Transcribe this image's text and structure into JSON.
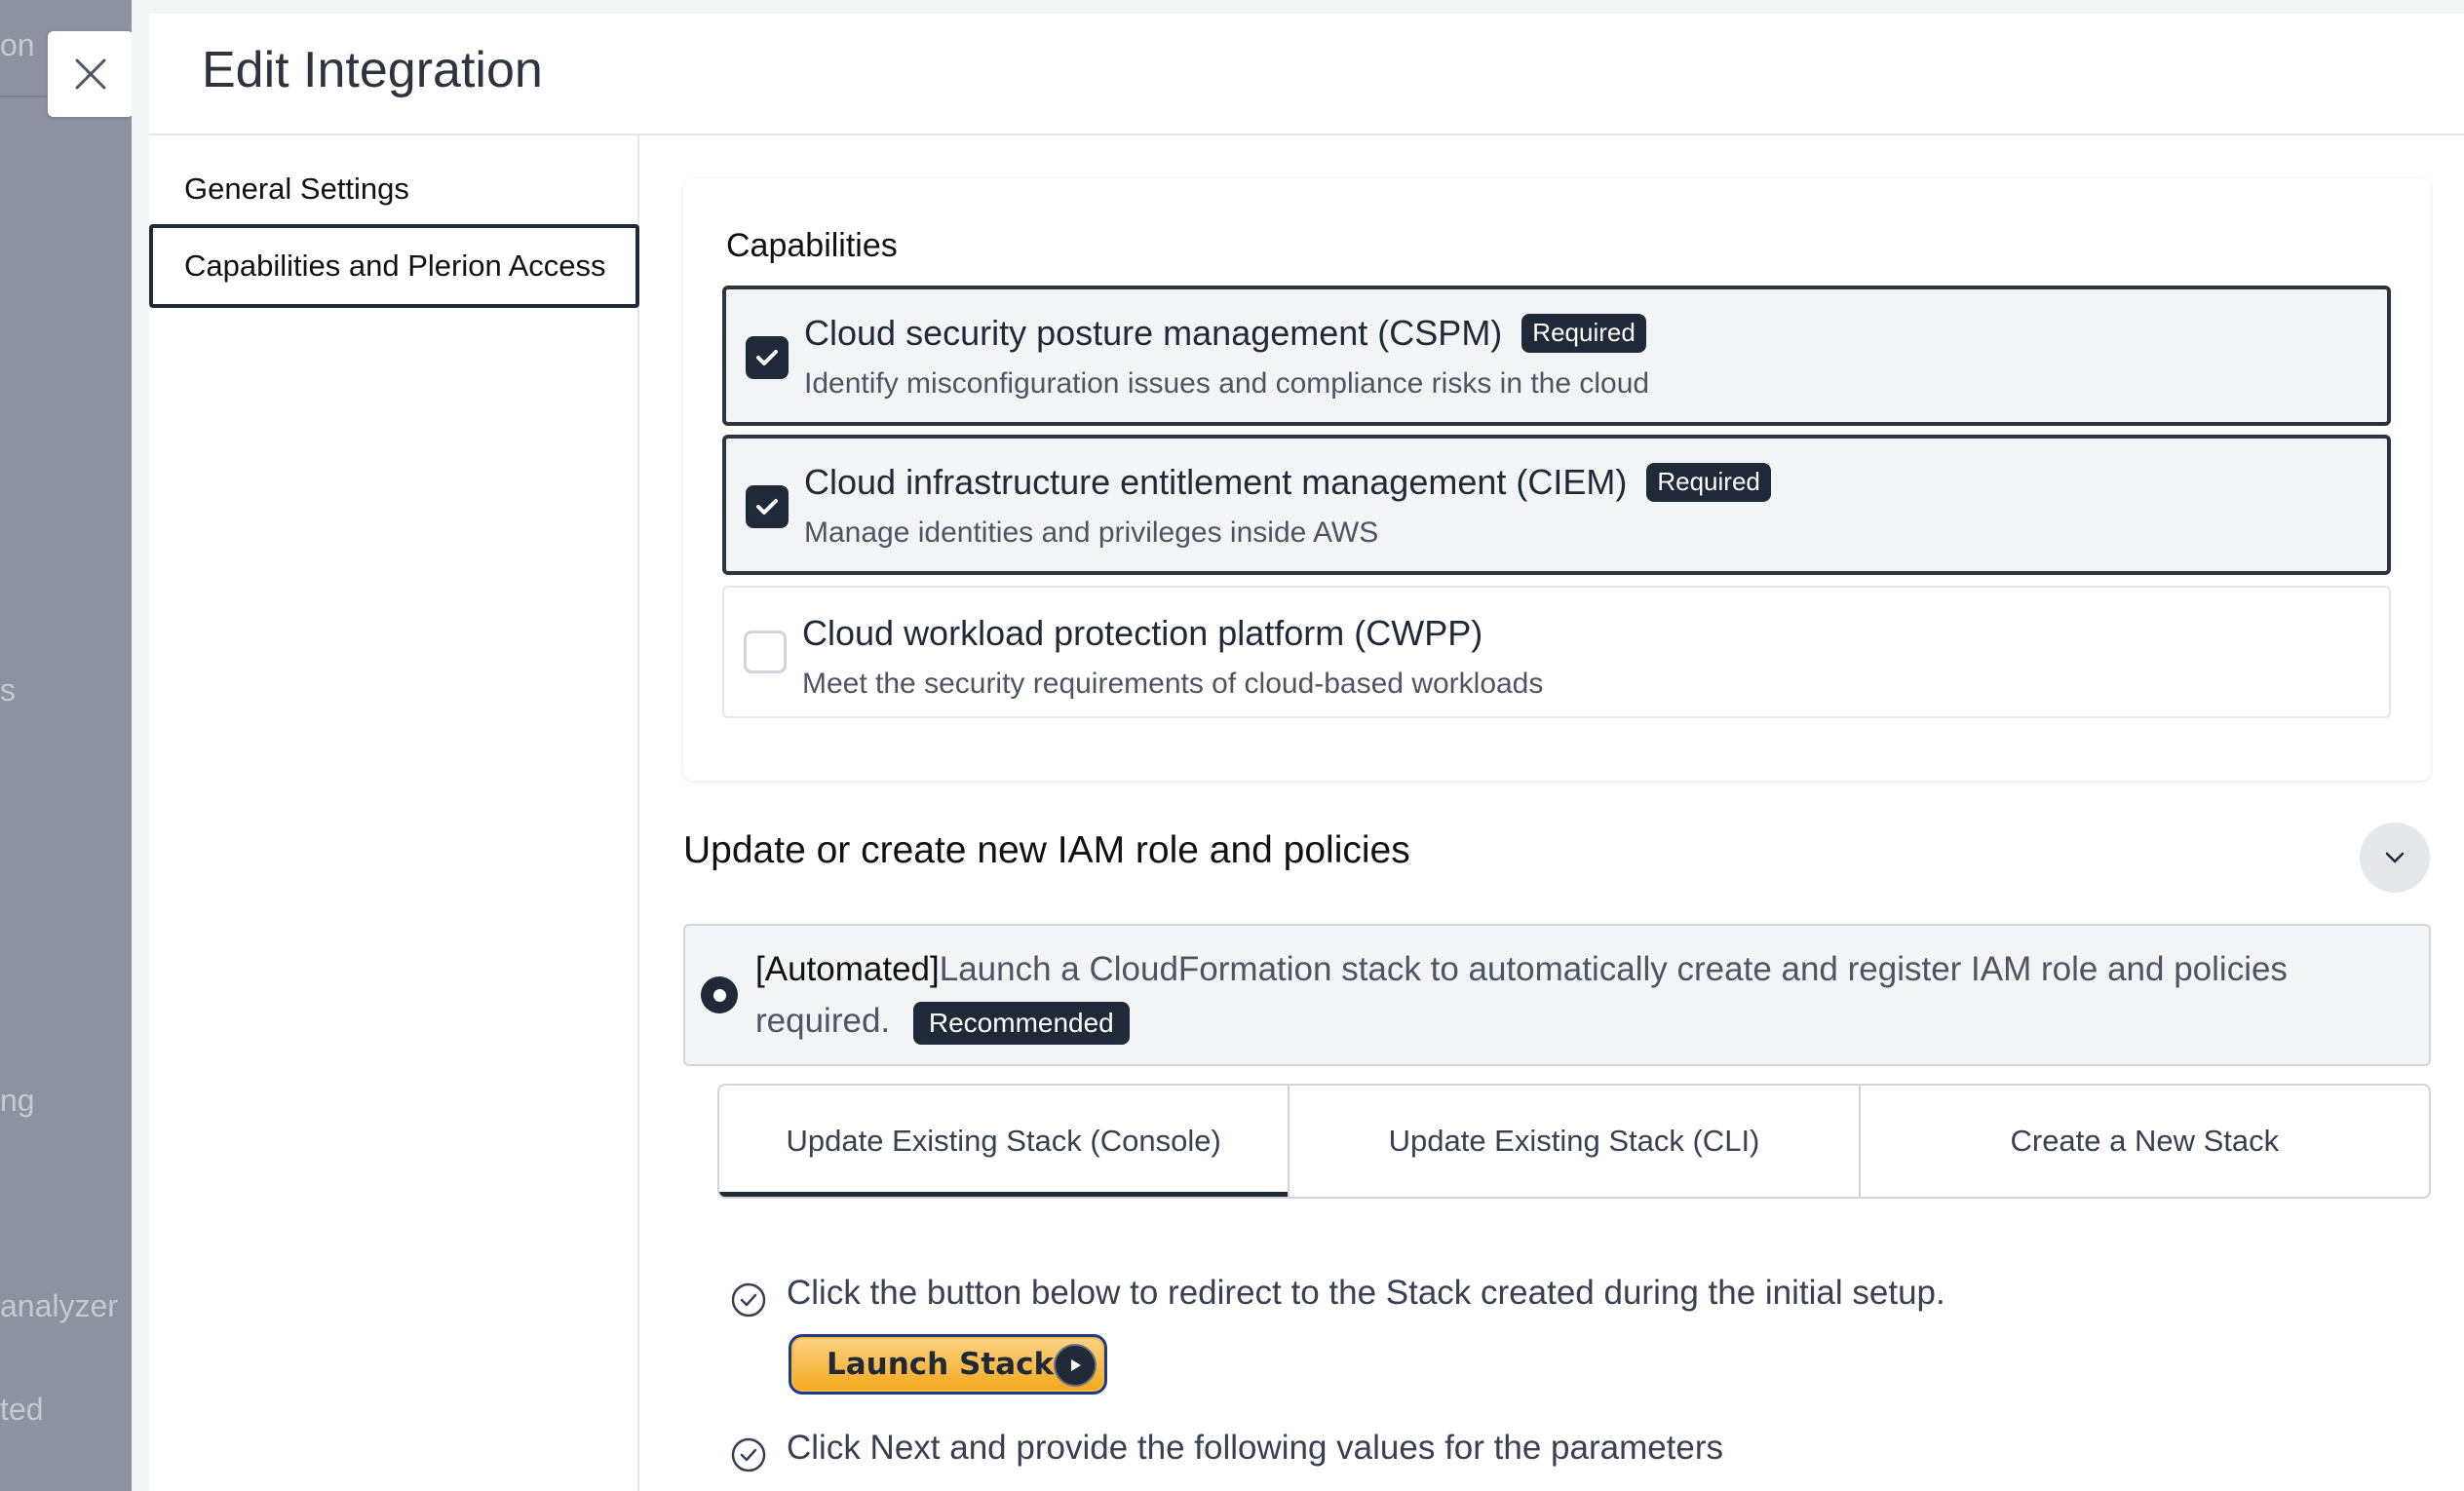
{
  "background_fragments": [
    "on",
    "s",
    "ng",
    "analyzer",
    "ted"
  ],
  "drawer": {
    "title": "Edit Integration"
  },
  "nav": {
    "items": [
      {
        "label": "General Settings",
        "active": false
      },
      {
        "label": "Capabilities and Plerion Access",
        "active": true
      }
    ]
  },
  "capabilities": {
    "title": "Capabilities",
    "options": [
      {
        "name": "Cloud security posture management (CSPM)",
        "badge": "Required",
        "description": "Identify misconfiguration issues and compliance risks in the cloud",
        "checked": true
      },
      {
        "name": "Cloud infrastructure entitlement management (CIEM)",
        "badge": "Required",
        "description": "Manage identities and privileges inside AWS",
        "checked": true
      },
      {
        "name": "Cloud workload protection platform (CWPP)",
        "badge": "",
        "description": "Meet the security requirements of cloud-based workloads",
        "checked": false
      }
    ]
  },
  "iam": {
    "title": "Update or create new IAM role and policies",
    "automated": {
      "prefix": "[Automated]",
      "text": "Launch a CloudFormation stack to automatically create and register IAM role and policies required.",
      "badge": "Recommended",
      "selected": true
    },
    "tabs": [
      {
        "label": "Update Existing Stack (Console)",
        "active": true
      },
      {
        "label": "Update Existing Stack (CLI)",
        "active": false
      },
      {
        "label": "Create a New Stack",
        "active": false
      }
    ],
    "steps": [
      "Click the button below to redirect to the Stack created during the initial setup.",
      "Click Next and provide the following values for the parameters"
    ],
    "launch_button": "Launch Stack"
  },
  "colors": {
    "dark": "#1f2937",
    "launch_orange": "#f3a71b",
    "overlay": "#8e929e"
  }
}
